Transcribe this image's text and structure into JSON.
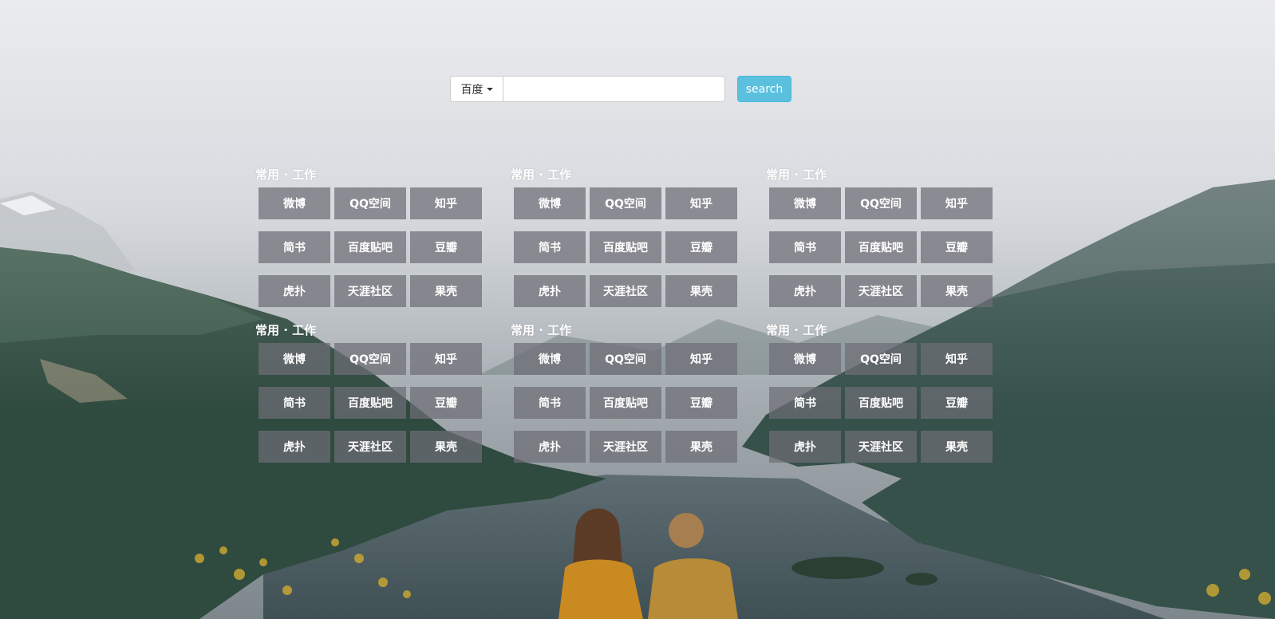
{
  "search": {
    "engine": "百度",
    "query": "",
    "placeholder": "",
    "button_label": "search"
  },
  "colors": {
    "search_button": "#5bc0de",
    "tile_background": "rgba(110,110,118,0.72)",
    "tile_text": "#ffffff"
  },
  "panels": [
    {
      "title": "常用 · 工作",
      "links": [
        "微博",
        "QQ空间",
        "知乎",
        "简书",
        "百度贴吧",
        "豆瓣",
        "虎扑",
        "天涯社区",
        "果壳"
      ]
    },
    {
      "title": "常用 · 工作",
      "links": [
        "微博",
        "QQ空间",
        "知乎",
        "简书",
        "百度贴吧",
        "豆瓣",
        "虎扑",
        "天涯社区",
        "果壳"
      ]
    },
    {
      "title": "常用 · 工作",
      "links": [
        "微博",
        "QQ空间",
        "知乎",
        "简书",
        "百度贴吧",
        "豆瓣",
        "虎扑",
        "天涯社区",
        "果壳"
      ]
    },
    {
      "title": "常用 · 工作",
      "links": [
        "微博",
        "QQ空间",
        "知乎",
        "简书",
        "百度贴吧",
        "豆瓣",
        "虎扑",
        "天涯社区",
        "果壳"
      ]
    },
    {
      "title": "常用 · 工作",
      "links": [
        "微博",
        "QQ空间",
        "知乎",
        "简书",
        "百度贴吧",
        "豆瓣",
        "虎扑",
        "天涯社区",
        "果壳"
      ]
    },
    {
      "title": "常用 · 工作",
      "links": [
        "微博",
        "QQ空间",
        "知乎",
        "简书",
        "百度贴吧",
        "豆瓣",
        "虎扑",
        "天涯社区",
        "果壳"
      ]
    }
  ]
}
